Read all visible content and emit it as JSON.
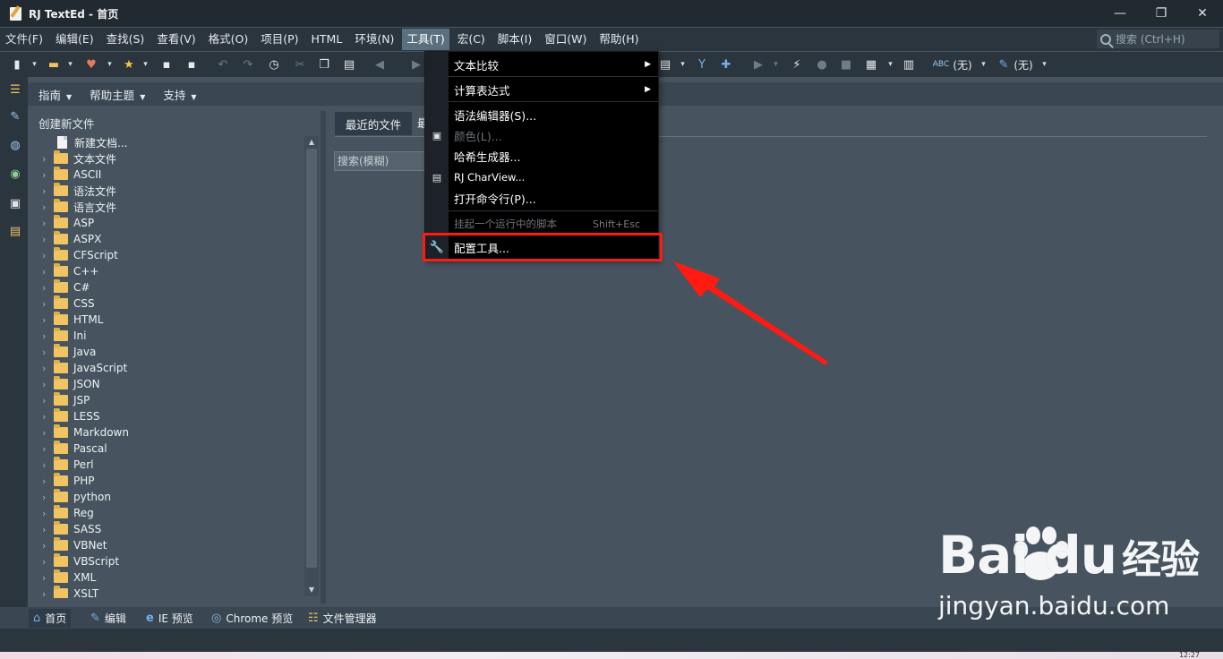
{
  "title": "RJ TextEd - 首页",
  "window_controls": {
    "minimize": "—",
    "maximize": "❐",
    "close": "✕"
  },
  "menu": [
    "文件(F)",
    "编辑(E)",
    "查找(S)",
    "查看(V)",
    "格式(O)",
    "项目(P)",
    "HTML",
    "环境(N)",
    "工具(T)",
    "宏(C)",
    "脚本(I)",
    "窗口(W)",
    "帮助(H)"
  ],
  "active_menu": "工具(T)",
  "search": {
    "placeholder": "搜索 (Ctrl+H)"
  },
  "toolbar": {
    "spell_label": "(无)",
    "style_label": "(无)"
  },
  "secondary_menu": [
    "指南",
    "帮助主题",
    "支持"
  ],
  "panel_title": "创建新文件",
  "tree_items": [
    "新建文档...",
    "文本文件",
    "ASCII",
    "语法文件",
    "语言文件",
    "ASP",
    "ASPX",
    "CFScript",
    "C++",
    "C#",
    "CSS",
    "HTML",
    "Ini",
    "Java",
    "JavaScript",
    "JSON",
    "JSP",
    "LESS",
    "Markdown",
    "Pascal",
    "Perl",
    "PHP",
    "python",
    "Reg",
    "SASS",
    "VBNet",
    "VBScript",
    "XML",
    "XSLT"
  ],
  "right_panel": {
    "tab_recent": "最近的文件",
    "tab_cut": "最",
    "search_placeholder": "搜索(模糊)"
  },
  "tools_menu": {
    "items": [
      {
        "label": "文本比较",
        "submenu": true
      },
      {
        "label": "计算表达式",
        "submenu": true
      },
      {
        "label": "语法编辑器(S)..."
      },
      {
        "label": "颜色(L)...",
        "disabled": true
      },
      {
        "label": "哈希生成器..."
      },
      {
        "label": "RJ CharView..."
      },
      {
        "label": "打开命令行(P)..."
      },
      {
        "label": "挂起一个运行中的脚本",
        "disabled": true,
        "shortcut": "Shift+Esc"
      },
      {
        "label": "配置工具...",
        "highlighted": true
      }
    ]
  },
  "bottom_tabs": [
    "首页",
    "编辑",
    "IE 预览",
    "Chrome 预览",
    "文件管理器"
  ],
  "watermark": {
    "logo_a": "Bai",
    "logo_b": "du",
    "logo_cn": "经验",
    "url": "jingyan.baidu.com"
  },
  "clock": "12:27",
  "colors": {
    "menu_bg": "#2b353e",
    "workspace": "#475460",
    "highlight": "#ff1a12",
    "folder": "#f0c462"
  }
}
